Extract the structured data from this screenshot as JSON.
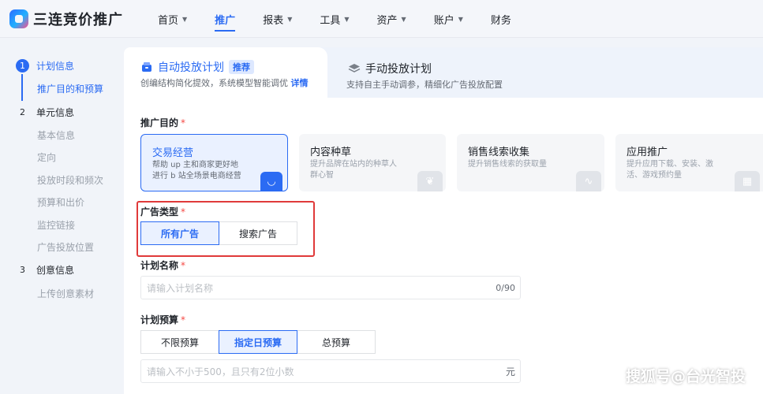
{
  "app": {
    "title": "三连竞价推广"
  },
  "nav": [
    {
      "label": "首页",
      "chevron": true,
      "active": false
    },
    {
      "label": "推广",
      "chevron": false,
      "active": true
    },
    {
      "label": "报表",
      "chevron": true,
      "active": false
    },
    {
      "label": "工具",
      "chevron": true,
      "active": false
    },
    {
      "label": "资产",
      "chevron": true,
      "active": false
    },
    {
      "label": "账户",
      "chevron": true,
      "active": false
    },
    {
      "label": "财务",
      "chevron": false,
      "active": false
    }
  ],
  "sidebar": {
    "steps": [
      {
        "num": "1",
        "label": "计划信息",
        "subs": [
          "推广目的和预算"
        ]
      },
      {
        "num": "2",
        "label": "单元信息",
        "subs": [
          "基本信息",
          "定向",
          "投放时段和频次",
          "预算和出价",
          "监控链接",
          "广告投放位置"
        ]
      },
      {
        "num": "3",
        "label": "创意信息",
        "subs": [
          "上传创意素材"
        ]
      }
    ]
  },
  "tabs": {
    "auto": {
      "title": "自动投放计划",
      "badge": "推荐",
      "desc": "创编结构简化提效，系统模型智能调优",
      "link": "详情"
    },
    "manual": {
      "title": "手动投放计划",
      "desc": "支持自主手动调参，精细化广告投放配置"
    }
  },
  "form": {
    "purpose": {
      "label": "推广目的",
      "options": [
        {
          "title": "交易经营",
          "desc1": "帮助 up 主和商家更好地",
          "desc2": "进行 b 站全场景电商经营"
        },
        {
          "title": "内容种草",
          "desc1": "提升品牌在站内的种草人",
          "desc2": "群心智"
        },
        {
          "title": "销售线索收集",
          "desc1": "提升销售线索的获取量",
          "desc2": ""
        },
        {
          "title": "应用推广",
          "desc1": "提升应用下载、安装、激",
          "desc2": "活、游戏预约量"
        }
      ]
    },
    "ad_type": {
      "label": "广告类型",
      "options": [
        "所有广告",
        "搜索广告"
      ],
      "selected": "所有广告"
    },
    "plan_name": {
      "label": "计划名称",
      "placeholder": "请输入计划名称",
      "counter": "0/90"
    },
    "budget": {
      "label": "计划预算",
      "options": [
        "不限预算",
        "指定日预算",
        "总预算"
      ],
      "selected": "指定日预算",
      "placeholder": "请输入不小于500，且只有2位小数",
      "unit": "元"
    },
    "required_mark": "*"
  },
  "watermark": "搜狐号@台光智投",
  "colors": {
    "accent": "#2b6bf3",
    "highlight_box": "#e03a3a",
    "required": "#f54a45"
  }
}
